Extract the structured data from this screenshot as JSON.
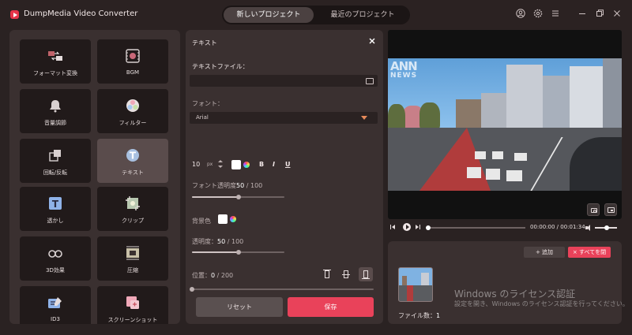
{
  "app": {
    "title": "DumpMedia Video Converter"
  },
  "project_tabs": {
    "new": "新しいプロジェクト",
    "recent": "最近のプロジェクト"
  },
  "window_icons": [
    "user-icon",
    "settings-icon",
    "menu-icon",
    "minimize-icon",
    "maximize-icon",
    "close-icon"
  ],
  "tools": [
    {
      "label": "フォーマット変換",
      "icon": "format-convert-icon",
      "color": "#c0636a"
    },
    {
      "label": "BGM",
      "icon": "bgm-icon",
      "color": "#b7a8a8"
    },
    {
      "label": "音量調節",
      "icon": "volume-bell-icon",
      "color": "#cfc3c3"
    },
    {
      "label": "フィルター",
      "icon": "filter-icon",
      "color": "#d8d0d0"
    },
    {
      "label": "回転/反転",
      "icon": "rotate-flip-icon",
      "color": "#cfc3c3"
    },
    {
      "label": "テキスト",
      "icon": "text-icon",
      "color": "#cfd6e8",
      "selected": true
    },
    {
      "label": "透かし",
      "icon": "watermark-icon",
      "color": "#8fb2e8"
    },
    {
      "label": "クリップ",
      "icon": "clip-icon",
      "color": "#b8c8b0"
    },
    {
      "label": "3D効果",
      "icon": "3d-glasses-icon",
      "color": "#cfc3c3"
    },
    {
      "label": "圧縮",
      "icon": "compress-icon",
      "color": "#c8c0a8"
    },
    {
      "label": "ID3",
      "icon": "id3-icon",
      "color": "#8fb2e8"
    },
    {
      "label": "スクリーンショット",
      "icon": "screenshot-icon",
      "color": "#f0a8b8"
    }
  ],
  "text_panel": {
    "title": "テキスト",
    "text_file_label": "テキストファイル：",
    "text_file_value": "",
    "font_label": "フォント：",
    "font_value": "Arial",
    "font_size": "10",
    "font_unit": "px",
    "font_color": "#ffffff",
    "bold_label": "B",
    "italic_label": "I",
    "underline_label": "U",
    "font_opacity_label": "フォント透明度",
    "font_opacity_value": "50",
    "font_opacity_max": "/ 100",
    "font_opacity_fraction": 0.5,
    "bg_color_label": "背景色",
    "bg_color": "#ffffff",
    "opacity_label": "透明度：",
    "opacity_value": "50",
    "opacity_max": "/ 100",
    "opacity_fraction": 0.5,
    "position_label": "位置：",
    "position_value": "0",
    "position_max": "/ 200",
    "position_fraction": 0,
    "reset_label": "リセット",
    "save_label": "保存"
  },
  "preview": {
    "watermark_line1": "ANN",
    "watermark_line2": "NEWS",
    "timecode": "00:00:00 / 00:01:34"
  },
  "files": {
    "add_label": "+ 追加",
    "close_all_label": "× すべてを閉",
    "count_label": "ファイル数：",
    "count_value": "1"
  },
  "windows_activation": {
    "title": "Windows のライセンス認証",
    "subtitle": "設定を開き、Windows のライセンス認証を行ってください。"
  }
}
